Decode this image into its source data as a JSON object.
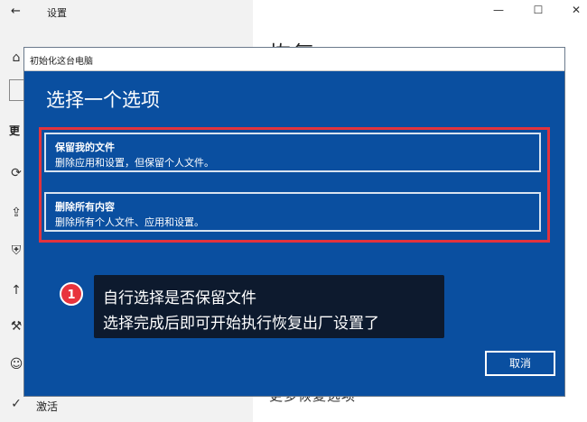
{
  "background_window": {
    "title": "设置",
    "sidebar": {
      "glyphs": [
        "命",
        "更"
      ],
      "bottom_item": "激活"
    },
    "main_heading": "恢复",
    "main_more_partial": "更多恢复选项"
  },
  "dialog": {
    "title": "初始化这台电脑",
    "heading": "选择一个选项",
    "options": [
      {
        "title": "保留我的文件",
        "description": "删除应用和设置，但保留个人文件。"
      },
      {
        "title": "删除所有内容",
        "description": "删除所有个人文件、应用和设置。"
      }
    ],
    "cancel_label": "取消"
  },
  "annotation": {
    "badge": "1",
    "lines": [
      "自行选择是否保留文件",
      "选择完成后即可开始执行恢复出厂设置了"
    ]
  },
  "colors": {
    "dialog_bg": "#0a4fa0",
    "highlight_border": "#e2333d",
    "annotation_bg": "#0d1a2e"
  }
}
